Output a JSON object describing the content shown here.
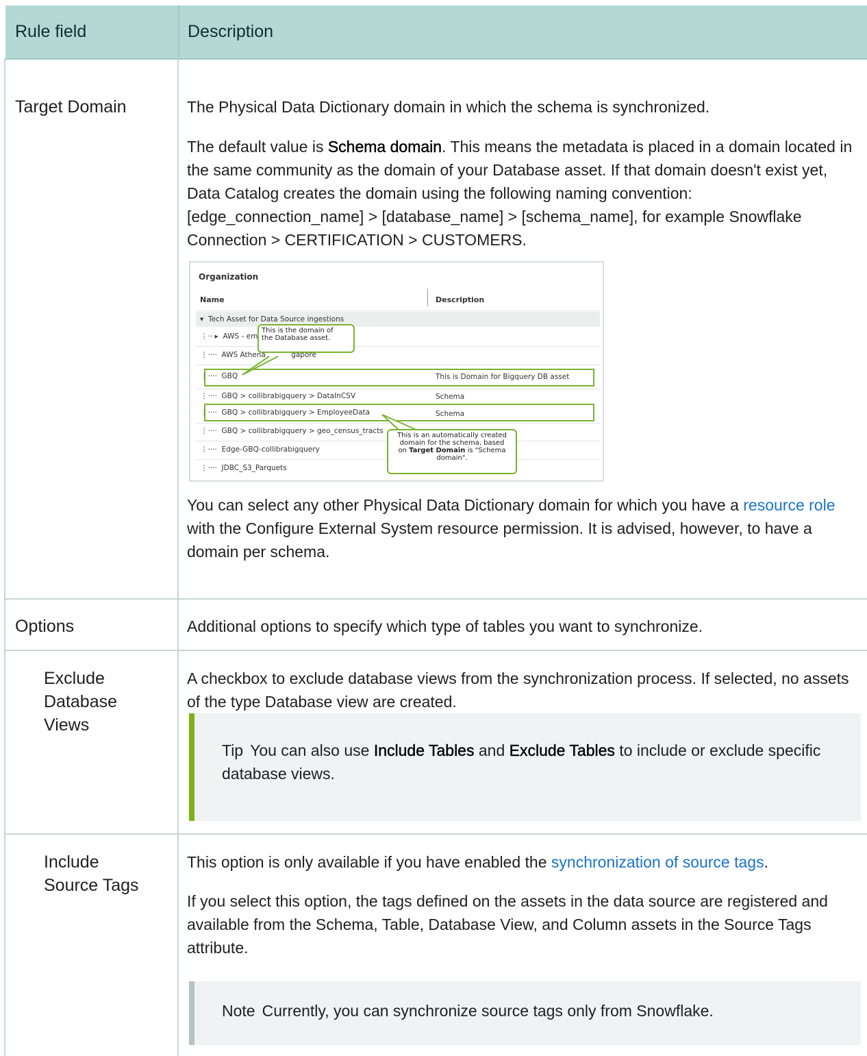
{
  "header": {
    "col1": "Rule field",
    "col2": "Description"
  },
  "rows": {
    "target_domain": {
      "field": "Target Domain",
      "p1": "The Physical Data Dictionary domain in which the schema is synchronized.",
      "p2_before": "The default value is ",
      "p2_bold": "Schema domain",
      "p2_after": ". This means the metadata is placed in a domain located in the same community as the domain of your Database asset. If that domain doesn't exist yet, Data Catalog creates the domain using the following naming convention: [edge_connection_name] > [database_name] > [schema_name], for example Snowflake Connection > CERTIFICATION > CUSTOMERS.",
      "p3_before": "You can select any other Physical Data Dictionary domain for which you have a ",
      "p3_link": "resource role",
      "p3_after": " with the Configure External System resource permission. It is advised, however, to have a domain per schema."
    },
    "options": {
      "field": "Options",
      "desc": "Additional options to specify which type of tables you want to synchronize."
    },
    "exclude_views": {
      "field_l1": "Exclude",
      "field_l2": "Database",
      "field_l3": "Views",
      "desc": "A checkbox to exclude database views from the synchronization process. If selected, no assets of the type Database view are created.",
      "tip_label": "Tip",
      "tip_before": "You can also use ",
      "tip_b1": "Include Tables",
      "tip_mid": " and ",
      "tip_b2": "Exclude Tables",
      "tip_after": " to include or exclude specific database views."
    },
    "source_tags": {
      "field_l1": "Include",
      "field_l2": "Source Tags",
      "p1_before": "This option is only available if you have enabled the ",
      "p1_link": "synchronization of source tags",
      "p1_after": ".",
      "p2": "If you select this option, the tags defined on the assets in the data source are registered and available from the Schema, Table, Database View, and Column assets in the Source Tags attribute.",
      "note_label": "Note",
      "note_text": "Currently, you can synchronize source tags only from Snowflake."
    }
  },
  "screenshot": {
    "title": "Organization",
    "col_name": "Name",
    "col_description": "Description",
    "rows": [
      {
        "name": "Tech Asset for Data Source ingestions",
        "desc": ""
      },
      {
        "name": "AWS - eme",
        "desc": ""
      },
      {
        "name": "AWS Athena",
        "suffix": "gapore",
        "desc": ""
      },
      {
        "name": "GBQ",
        "desc": "This is Domain for Bigquery DB asset"
      },
      {
        "name": "GBQ > collibrabigquery > DataInCSV",
        "desc": "Schema"
      },
      {
        "name": "GBQ > collibrabigquery > EmployeeData",
        "desc": "Schema"
      },
      {
        "name": "GBQ > collibrabigquery > geo_census_tracts",
        "desc": ""
      },
      {
        "name": "Edge-GBQ-collibrabigquery",
        "desc": ""
      },
      {
        "name": "JDBC_S3_Parquets",
        "desc": ""
      }
    ],
    "bubble1_l1": "This is the domain of",
    "bubble1_l2": "the Database asset.",
    "bubble2_l1": "This is an automatically created",
    "bubble2_l2": "domain for the schema, based",
    "bubble2_l3_before": "on ",
    "bubble2_l3_bold": "Target Domain",
    "bubble2_l3_after": " is \"Schema",
    "bubble2_l4": "domain\"."
  },
  "colors": {
    "header_bg": "#b4d8d3",
    "tip_bar": "#7ab317",
    "note_bar": "#b6c2c9",
    "link": "#1a73c9"
  }
}
